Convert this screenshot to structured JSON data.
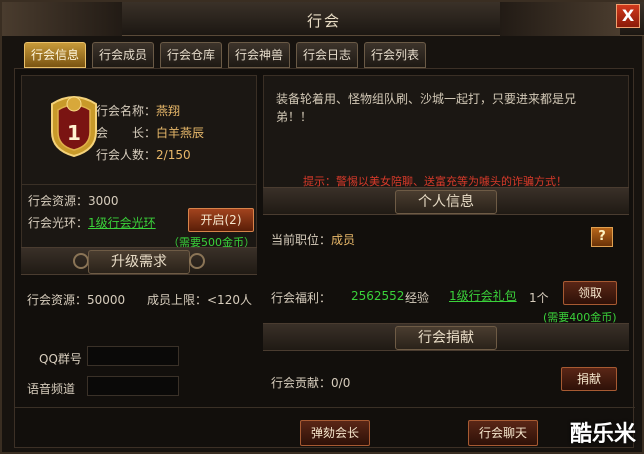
{
  "window": {
    "title": "行会",
    "close_label": "X"
  },
  "tabs": [
    {
      "label": "行会信息"
    },
    {
      "label": "行会成员"
    },
    {
      "label": "行会仓库"
    },
    {
      "label": "行会神兽"
    },
    {
      "label": "行会日志"
    },
    {
      "label": "行会列表"
    }
  ],
  "guild": {
    "level": "1",
    "name_label": "行会名称：",
    "name_value": "燕翔",
    "leader_label": "会　　长：",
    "leader_value": "白羊燕辰",
    "members_label": "行会人数：",
    "members_value": "2/150",
    "resources_label": "行会资源：3000",
    "aura_label": "行会光环：",
    "aura_link": "1级行会光环",
    "open_button": "开启(2)",
    "open_cost": "（需要500金币）"
  },
  "notice": {
    "text": "装备轮着用、怪物组队刷、沙城一起打，只要进来都是兄弟！！",
    "tip": "提示：警惕以美女陪聊、送富充等为噱头的诈骗方式！"
  },
  "upgrade": {
    "heading": "升级需求",
    "resources": "行会资源：50000",
    "member_limit": "成员上限：<120人",
    "qq_label": "QQ群号",
    "voice_label": "语音频道"
  },
  "personal": {
    "heading": "个人信息",
    "position_label": "当前职位：",
    "position_value": "成员",
    "help_icon": "?",
    "welfare_label": "行会福利：",
    "exp_value": "2562552",
    "exp_unit": "经验",
    "gift_link": "1级行会礼包",
    "gift_count": "1个",
    "claim_button": "领取",
    "claim_cost": "(需要400金币)"
  },
  "donate": {
    "heading": "行会捐献",
    "contribution_label": "行会贡献：",
    "contribution_value": "0/0",
    "donate_button": "捐献"
  },
  "footer": {
    "impeach_button": "弹劾会长",
    "chat_button": "行会聊天",
    "watermark": "酷乐米"
  }
}
